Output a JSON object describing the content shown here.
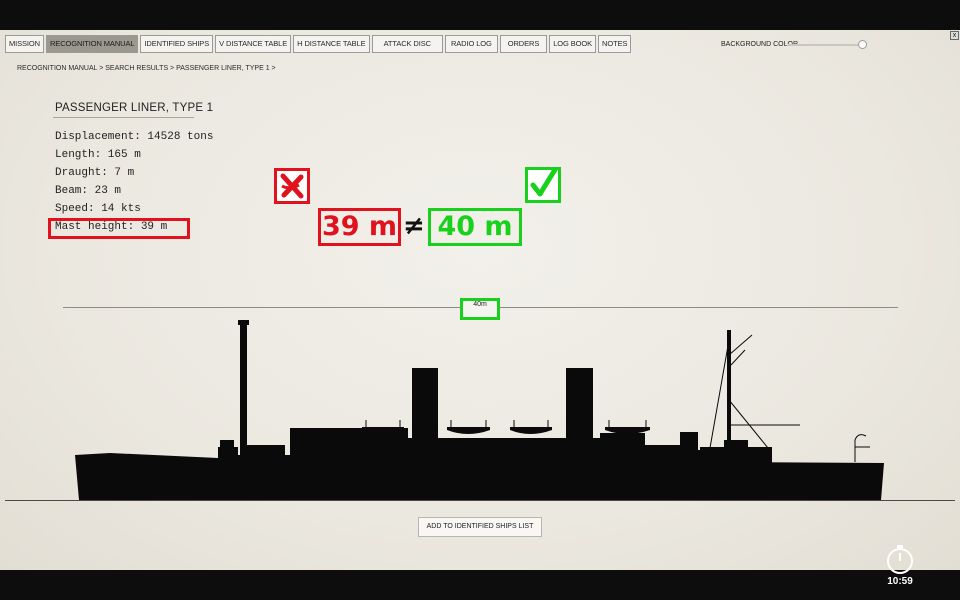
{
  "tabs": [
    {
      "label": "Mission",
      "active": false
    },
    {
      "label": "Recognition Manual",
      "active": true
    },
    {
      "label": "Identified Ships",
      "active": false
    },
    {
      "label": "V Distance Table",
      "active": false
    },
    {
      "label": "H Distance Table",
      "active": false
    },
    {
      "label": "Attack Disc",
      "active": false
    },
    {
      "label": "Radio Log",
      "active": false
    },
    {
      "label": "Orders",
      "active": false
    },
    {
      "label": "Log Book",
      "active": false
    },
    {
      "label": "Notes",
      "active": false
    }
  ],
  "background_color_label": "Background Color",
  "background_color_level": 0.95,
  "close_label": "x",
  "breadcrumb": "Recognition Manual > Search Results > Passenger Liner, Type 1 >",
  "ship": {
    "title": "Passenger Liner, Type 1",
    "specs": [
      "Displacement: 14528 tons",
      "Length: 165 m",
      "Draught: 7 m",
      "Beam: 23 m",
      "Speed: 14 kts",
      "Mast height: 39 m"
    ]
  },
  "annotation": {
    "listed_value": "39 m",
    "not_equal": "≠",
    "measured_value": "40 m",
    "height_marker": "40m",
    "wrong_mark": "x-mark-icon",
    "correct_mark": "check-mark-icon",
    "wrong_color": "#e0121d",
    "correct_color": "#19d11c"
  },
  "add_button_label": "Add to Identified Ships List",
  "timer": {
    "icon": "stopwatch-icon",
    "time": "10:59"
  }
}
